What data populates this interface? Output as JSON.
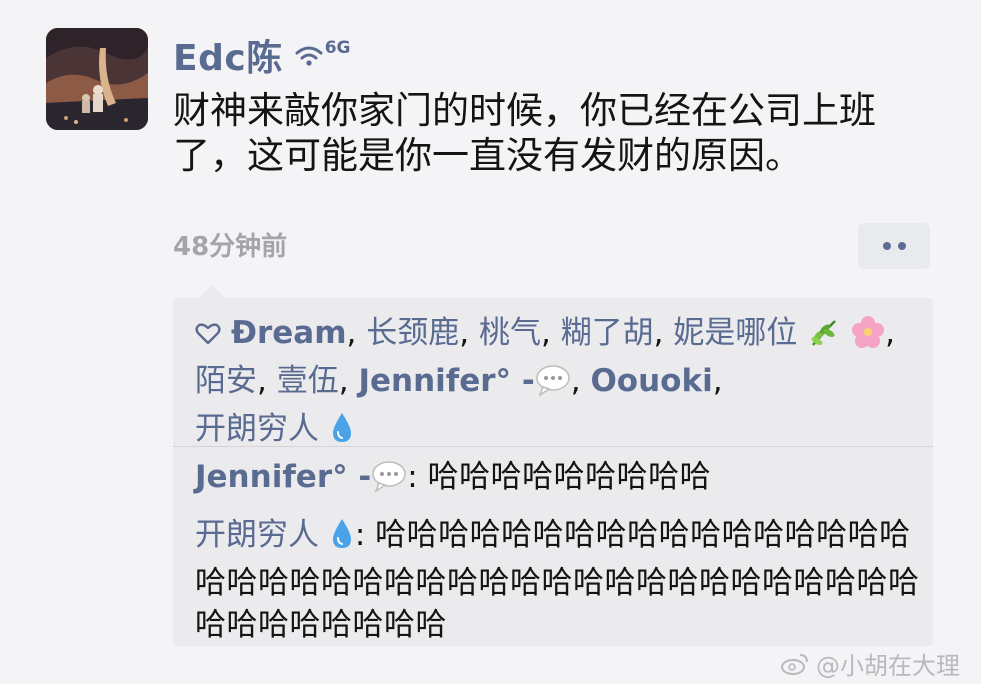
{
  "post": {
    "username": "Edc陈",
    "network_label": "6G",
    "content": "财神来敲你家门的时候，你已经在公司上班了，这可能是你一直没有发财的原因。",
    "time": "48分钟前"
  },
  "likes": {
    "names": [
      {
        "text": "Đream",
        "bold": true
      },
      {
        "text": "长颈鹿",
        "bold": false
      },
      {
        "text": "桃气",
        "bold": false
      },
      {
        "text": "糊了胡",
        "bold": false
      },
      {
        "text": "妮是哪位",
        "bold": false
      },
      {
        "text": "陌安",
        "bold": false
      },
      {
        "text": "壹伍",
        "bold": false
      },
      {
        "text": "Jennifer° -",
        "bold": true
      },
      {
        "text": "Oouoki",
        "bold": true
      },
      {
        "text": "开朗穷人",
        "bold": false
      }
    ],
    "separator": ", "
  },
  "comments": [
    {
      "author": "Jennifer° -",
      "text": "哈哈哈哈哈哈哈哈哈"
    },
    {
      "author": "开朗穷人",
      "text": "哈哈哈哈哈哈哈哈哈哈哈哈哈哈哈哈哈哈哈哈哈哈哈哈哈哈哈哈哈哈哈哈哈哈哈哈哈哈哈哈哈哈哈哈哈哈哈哈"
    }
  ],
  "watermark": "@小胡在大理",
  "colors": {
    "name_blue": "#5a6b91",
    "background": "#f4f4f6",
    "panel": "#ebebee"
  },
  "icons": [
    "heart-icon",
    "wifi-icon",
    "herb-emoji",
    "blossom-emoji",
    "speech-bubble-emoji",
    "droplet-emoji",
    "more-icon",
    "weibo-icon"
  ]
}
